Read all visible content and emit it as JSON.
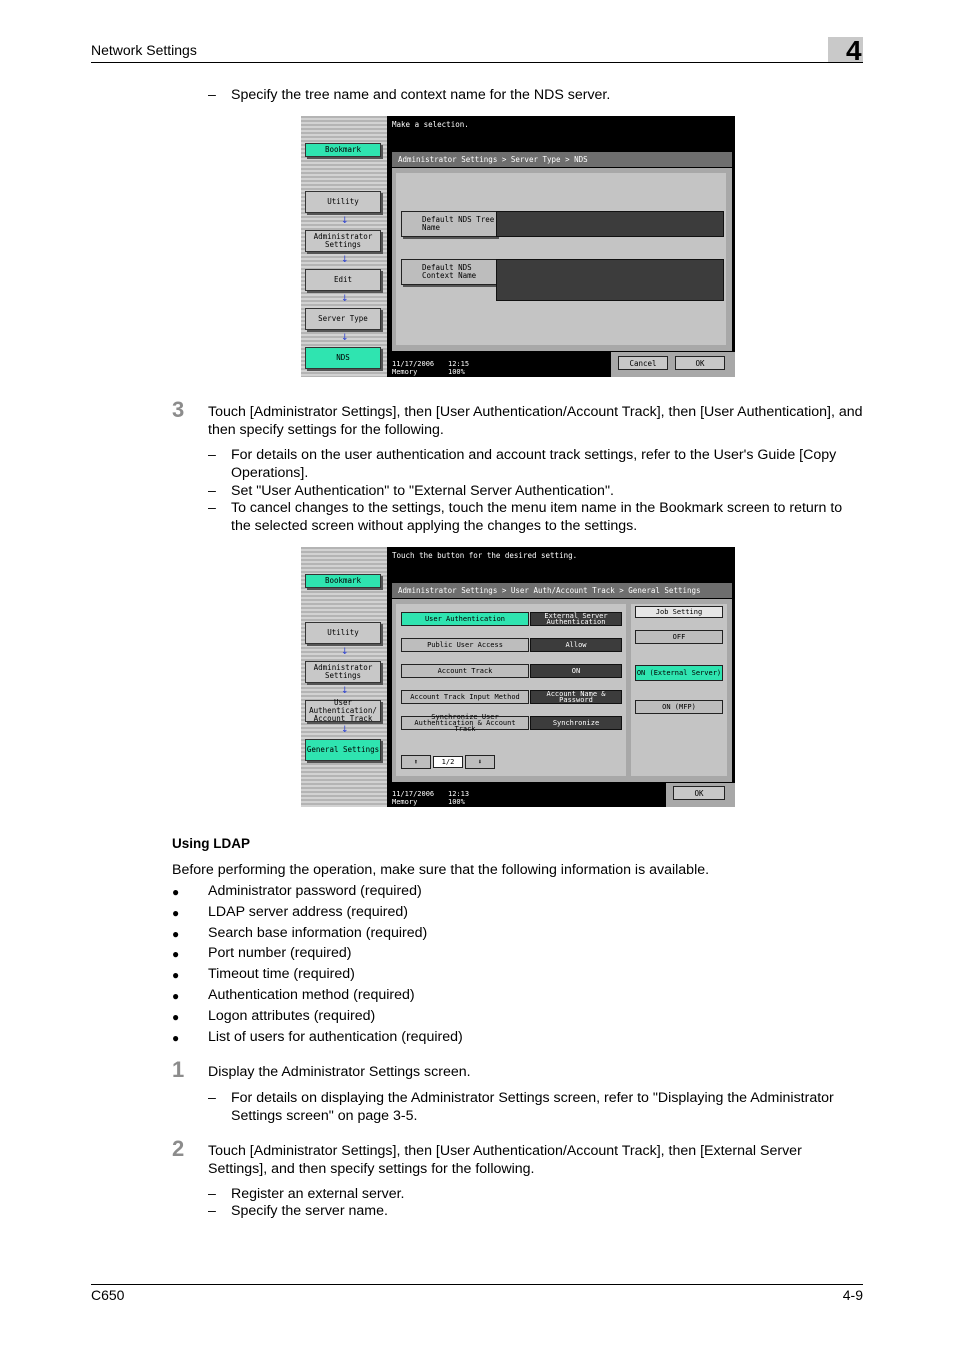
{
  "header": {
    "title": "Network Settings",
    "chapter": "4"
  },
  "footer": {
    "model": "C650",
    "page": "4-9"
  },
  "intro_dash": "Specify the tree name and context name for the NDS server.",
  "screen1": {
    "message": "Make a selection.",
    "breadcrumb": "Administrator Settings > Server Type > NDS",
    "sidebar": [
      "Bookmark",
      "Utility",
      "Administrator Settings",
      "Edit",
      "Server Type",
      "NDS"
    ],
    "tree_label": "Default NDS Tree Name",
    "context_label": "Default NDS Context Name",
    "date": "11/17/2006",
    "time": "12:15",
    "memory_label": "Memory",
    "memory_value": "100%",
    "cancel": "Cancel",
    "ok": "OK"
  },
  "step3": {
    "num": "3",
    "text": "Touch [Administrator Settings], then [User Authentication/Account Track], then [User Authentication], and then specify settings for the following.",
    "dashes": [
      "For details on the user authentication and account track settings, refer to the User's Guide [Copy Operations].",
      "Set \"User Authentication\" to \"External Server Authentication\".",
      "To cancel changes to the settings, touch the menu item name in the Bookmark screen to return to the selected screen without applying the changes to the settings."
    ]
  },
  "screen2": {
    "message": "Touch the button for the desired setting.",
    "breadcrumb": "Administrator Settings > User Auth/Account Track > General Settings",
    "sidebar": [
      "Bookmark",
      "Utility",
      "Administrator Settings",
      "User Authentication/ Account Track",
      "General Settings"
    ],
    "rows": [
      {
        "label": "User Authentication",
        "value": "External Server Authentication"
      },
      {
        "label": "Public User Access",
        "value": "Allow"
      },
      {
        "label": "Account Track",
        "value": "ON"
      },
      {
        "label": "Account Track Input Method",
        "value": "Account Name & Password"
      },
      {
        "label": "Synchronize User Authentication & Account Track",
        "value": "Synchronize"
      }
    ],
    "job_setting": "Job Setting",
    "off": "OFF",
    "on_external": "ON (External Server)",
    "on_mfp": "ON (MFP)",
    "page": "1/2",
    "date": "11/17/2006",
    "time": "12:13",
    "memory_label": "Memory",
    "memory_value": "100%",
    "ok": "OK"
  },
  "ldap": {
    "heading": "Using LDAP",
    "intro": "Before performing the operation, make sure that the following information is available.",
    "bullets": [
      "Administrator password (required)",
      "LDAP server address (required)",
      "Search base information (required)",
      "Port number (required)",
      "Timeout time (required)",
      "Authentication method (required)",
      "Logon attributes (required)",
      "List of users for authentication (required)"
    ]
  },
  "step1": {
    "num": "1",
    "text": "Display the Administrator Settings screen.",
    "dash": "For details on displaying the Administrator Settings screen, refer to \"Displaying the Administrator Settings screen\" on page 3-5."
  },
  "step2": {
    "num": "2",
    "text": "Touch [Administrator Settings], then [User Authentication/Account Track], then [External Server Settings], and then specify settings for the following.",
    "dashes": [
      "Register an external server.",
      "Specify the server name."
    ]
  }
}
